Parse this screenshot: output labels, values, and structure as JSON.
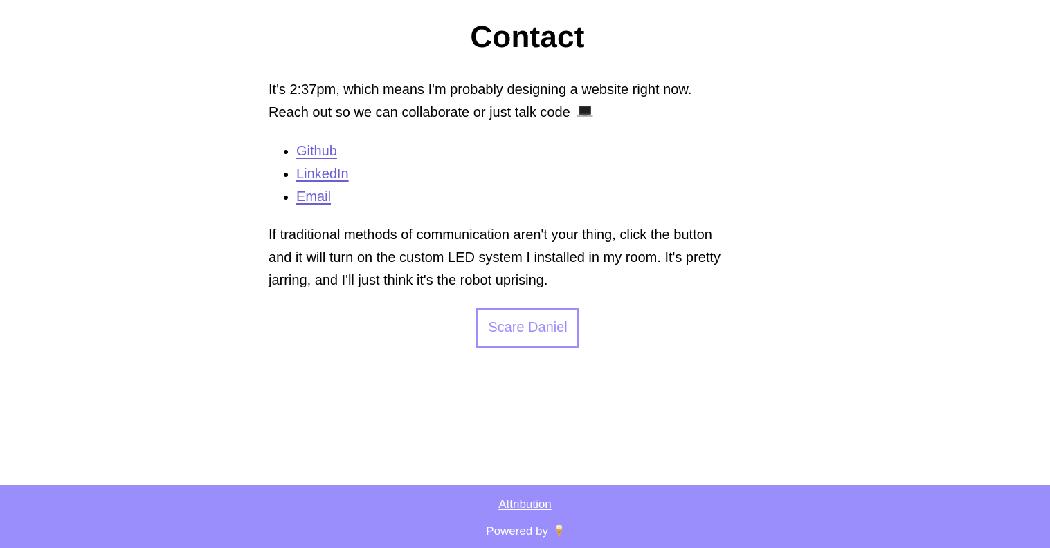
{
  "page": {
    "title": "Contact"
  },
  "intro": {
    "line1": "It's 2:37pm, which means I'm probably designing a website right now.",
    "line2": "Reach out so we can collaborate or just talk code"
  },
  "links": [
    {
      "label": "Github"
    },
    {
      "label": "LinkedIn"
    },
    {
      "label": "Email"
    }
  ],
  "blurb": {
    "line1": "If traditional methods of communication aren't your thing, click the button",
    "line2": "and it will turn on the custom LED system I installed in my room. It's pretty",
    "line3": "jarring, and I'll just think it's the robot uprising."
  },
  "scare_button": {
    "label": "Scare Daniel"
  },
  "footer": {
    "attribution_label": "Attribution",
    "powered_by_label": "Powered by"
  },
  "colors": {
    "accent": "#9a8efc",
    "link": "#6b5fd6",
    "text": "#000000",
    "background": "#ffffff"
  },
  "icons": {
    "intro_emoji": "laptop-icon",
    "footer_emoji": "ice-cream-icon"
  }
}
